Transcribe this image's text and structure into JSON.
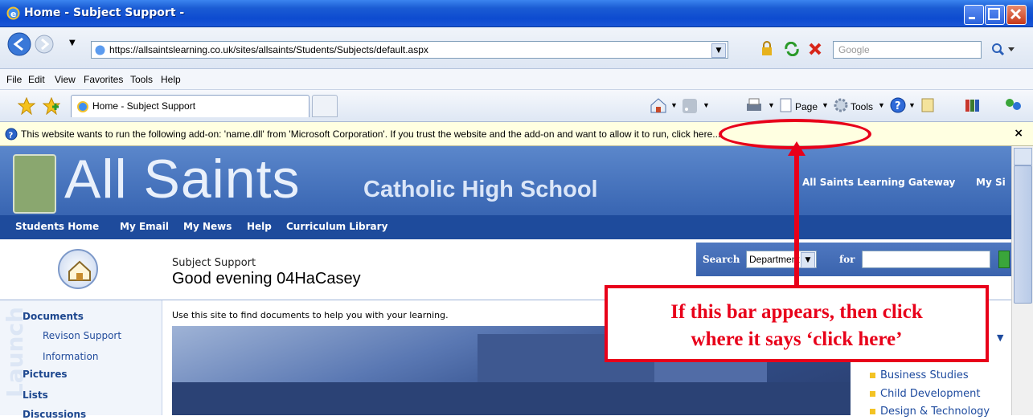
{
  "window": {
    "title": "Home - Subject Support -"
  },
  "addressbar": {
    "url": "https://allsaintslearning.co.uk/sites/allsaints/Students/Subjects/default.aspx",
    "search_placeholder": "Google"
  },
  "menu": [
    "File",
    "Edit",
    "View",
    "Favorites",
    "Tools",
    "Help"
  ],
  "tabs": [
    {
      "label": "Home - Subject Support"
    }
  ],
  "commandbar": {
    "page": "Page",
    "tools": "Tools"
  },
  "infobar": {
    "text": "This website wants to run the following add-on: 'name.dll' from 'Microsoft Corporation'. If you trust the website and the add-on and want to allow it to run, click here...",
    "close": "×"
  },
  "site": {
    "title": "All Saints",
    "subtitle": "Catholic High School",
    "gateway_link": "All Saints Learning Gateway",
    "my_site": "My Si",
    "topnav": [
      "Students Home",
      "My Email",
      "My News",
      "Help",
      "Curriculum Library"
    ],
    "breadcrumb": "Subject Support",
    "greeting": "Good evening 04HaCasey",
    "search_label": "Search",
    "search_scope": "Department",
    "search_for": "for",
    "quicklaunch_watermark": "Launch",
    "leftnav": [
      {
        "label": "Documents",
        "bold": true
      },
      {
        "label": "Revison Support",
        "bold": false
      },
      {
        "label": "Information",
        "bold": false
      },
      {
        "label": "Pictures",
        "bold": true
      },
      {
        "label": "Lists",
        "bold": true
      },
      {
        "label": "Discussions",
        "bold": true
      }
    ],
    "intro": "Use this site to find documents to help you with your learning.",
    "subjects": [
      "Business Studies",
      "Child Development",
      "Design & Technology"
    ]
  },
  "annotation": {
    "line1": "If this bar appears, then click",
    "line2": "where it says ‘click here’"
  },
  "colors": {
    "annotation": "#e8001a",
    "banner": "#3865b2",
    "infobar": "#ffffe1"
  }
}
